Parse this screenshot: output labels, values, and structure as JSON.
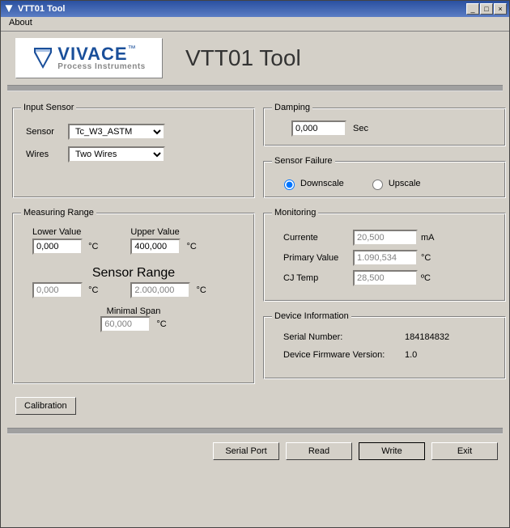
{
  "window": {
    "title": "VTT01 Tool",
    "menu": {
      "about": "About"
    },
    "min_sym": "_",
    "max_sym": "□",
    "close_sym": "×"
  },
  "branding": {
    "brand_name": "VIVACE",
    "brand_tm": "™",
    "brand_tagline": "Process Instruments",
    "app_heading": "VTT01 Tool",
    "accent_color": "#1a4f9a"
  },
  "input_sensor": {
    "legend": "Input Sensor",
    "sensor_label": "Sensor",
    "sensor_value": "Tc_W3_ASTM",
    "wires_label": "Wires",
    "wires_value": "Two Wires"
  },
  "measuring_range": {
    "legend": "Measuring Range",
    "lower_label": "Lower Value",
    "lower_value": "0,000",
    "upper_label": "Upper Value",
    "upper_value": "400,000",
    "unit": "°C",
    "sensor_range_title": "Sensor Range",
    "sr_lower": "0,000",
    "sr_upper": "2.000,000",
    "min_span_label": "Minimal Span",
    "min_span_value": "60,000"
  },
  "damping": {
    "legend": "Damping",
    "value": "0,000",
    "unit": "Sec"
  },
  "sensor_failure": {
    "legend": "Sensor Failure",
    "downscale_label": "Downscale",
    "upscale_label": "Upscale",
    "selected": "downscale"
  },
  "monitoring": {
    "legend": "Monitoring",
    "current_label": "Currente",
    "current_value": "20,500",
    "current_unit": "mA",
    "primary_label": "Primary Value",
    "primary_value": "1.090,534",
    "primary_unit": "°C",
    "cj_label": "CJ Temp",
    "cj_value": "28,500",
    "cj_unit": "ºC"
  },
  "device_info": {
    "legend": "Device Information",
    "serial_label": "Serial Number:",
    "serial_value": "184184832",
    "fw_label": "Device Firmware Version:",
    "fw_value": "1.0"
  },
  "buttons": {
    "calibration": "Calibration",
    "serial_port": "Serial Port",
    "read": "Read",
    "write": "Write",
    "exit": "Exit"
  }
}
